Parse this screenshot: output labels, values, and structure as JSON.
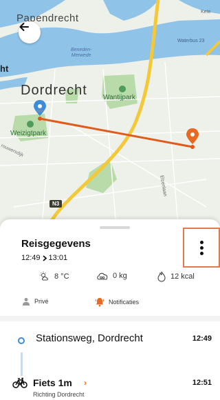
{
  "map": {
    "labels": {
      "papendrecht": "Papendrecht",
      "dordrecht": "Dordrecht",
      "ht": "ht",
      "beneden": "Beneden-\nMerwede",
      "waterbus": "Waterbus 23",
      "kete": "Kete",
      "wantijpark": "Wantijpark",
      "weizigtpark": "Weizigtpark",
      "elzenlaan": "Elzenlaan",
      "bieswerdlijk": "rouwersdijk",
      "road_n3": "N3"
    },
    "colors": {
      "water": "#8fc3e8",
      "park": "#b9dba9",
      "highway": "#f3c93a",
      "route": "#e05a1b",
      "start": "#3b8dd8"
    }
  },
  "sheet": {
    "title": "Reisgegevens",
    "time_start": "12:49",
    "time_end": "13:01",
    "stats": {
      "temperature": "8 °C",
      "co2": "0 kg",
      "calories": "12 kcal"
    },
    "privacy_label": "Privé",
    "notifications_label": "Notificaties",
    "stop": {
      "name": "Stationsweg, Dordrecht",
      "time": "12:49"
    },
    "leg": {
      "title": "Fiets 1m",
      "time": "12:51",
      "subtitle": "Richting Dordrecht"
    }
  }
}
